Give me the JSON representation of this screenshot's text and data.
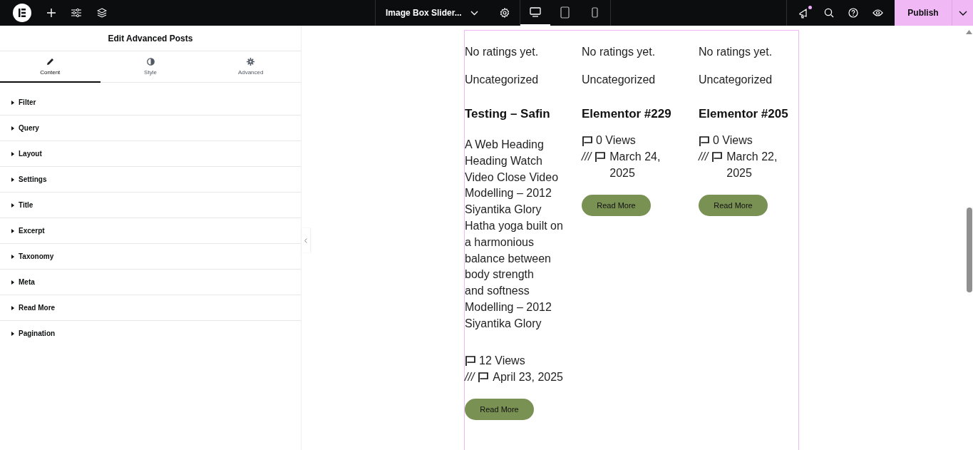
{
  "top_bar": {
    "page_title": "Image Box Slider...",
    "devices": [
      {
        "kind": "desktop",
        "selected": true
      },
      {
        "kind": "tablet",
        "selected": false
      },
      {
        "kind": "mobile",
        "selected": false
      }
    ],
    "notification_unread": true,
    "publish": "Publish"
  },
  "panel": {
    "title": "Edit Advanced Posts",
    "tabs": [
      {
        "label": "Content",
        "kind": "pencil",
        "selected": true
      },
      {
        "label": "Style",
        "kind": "contrast",
        "selected": false
      },
      {
        "label": "Advanced",
        "kind": "gear",
        "selected": false
      }
    ],
    "sections": [
      {
        "label": "Filter",
        "expanded": false
      },
      {
        "label": "Query",
        "expanded": false
      },
      {
        "label": "Layout",
        "expanded": false
      },
      {
        "label": "Settings",
        "expanded": false
      },
      {
        "label": "Title",
        "expanded": false
      },
      {
        "label": "Excerpt",
        "expanded": false
      },
      {
        "label": "Taxonomy",
        "expanded": false
      },
      {
        "label": "Meta",
        "expanded": false
      },
      {
        "label": "Read More",
        "expanded": false
      },
      {
        "label": "Pagination",
        "expanded": false
      }
    ]
  },
  "posts": [
    {
      "rating": "No ratings yet.",
      "category": "Uncategorized",
      "title": "Testing – Safin",
      "excerpt": "A Web Heading\nHeading Watch\nVideo Close Video\nModelling – 2012\nSiyantika Glory\nHatha yoga built on\na harmonious\nbalance between\nbody strength\nand softness\nModelling – 2012\nSiyantika Glory",
      "views": "12 Views",
      "separator": "///",
      "date": "April 23, 2025",
      "button": "Read More"
    },
    {
      "rating": "No ratings yet.",
      "category": "Uncategorized",
      "title": "Elementor #229",
      "views": "0 Views",
      "separator": "///",
      "date": "March 24, 2025",
      "button": "Read More"
    },
    {
      "rating": "No ratings yet.",
      "category": "Uncategorized",
      "title": "Elementor #205",
      "views": "0 Views",
      "separator": "///",
      "date": "March 22, 2025",
      "button": "Read More"
    }
  ]
}
